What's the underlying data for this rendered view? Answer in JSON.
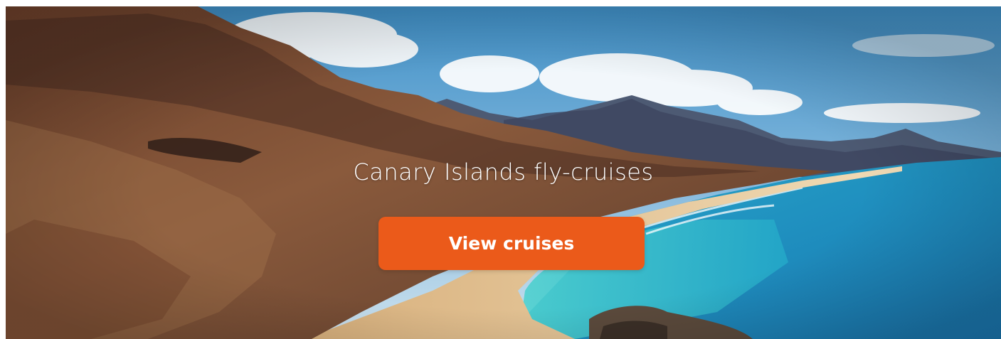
{
  "hero": {
    "title": "Canary Islands fly-cruises",
    "button_label": "View cruises",
    "button_color": "#EB5A1A",
    "image": "canary-islands-coastline-landscape"
  }
}
